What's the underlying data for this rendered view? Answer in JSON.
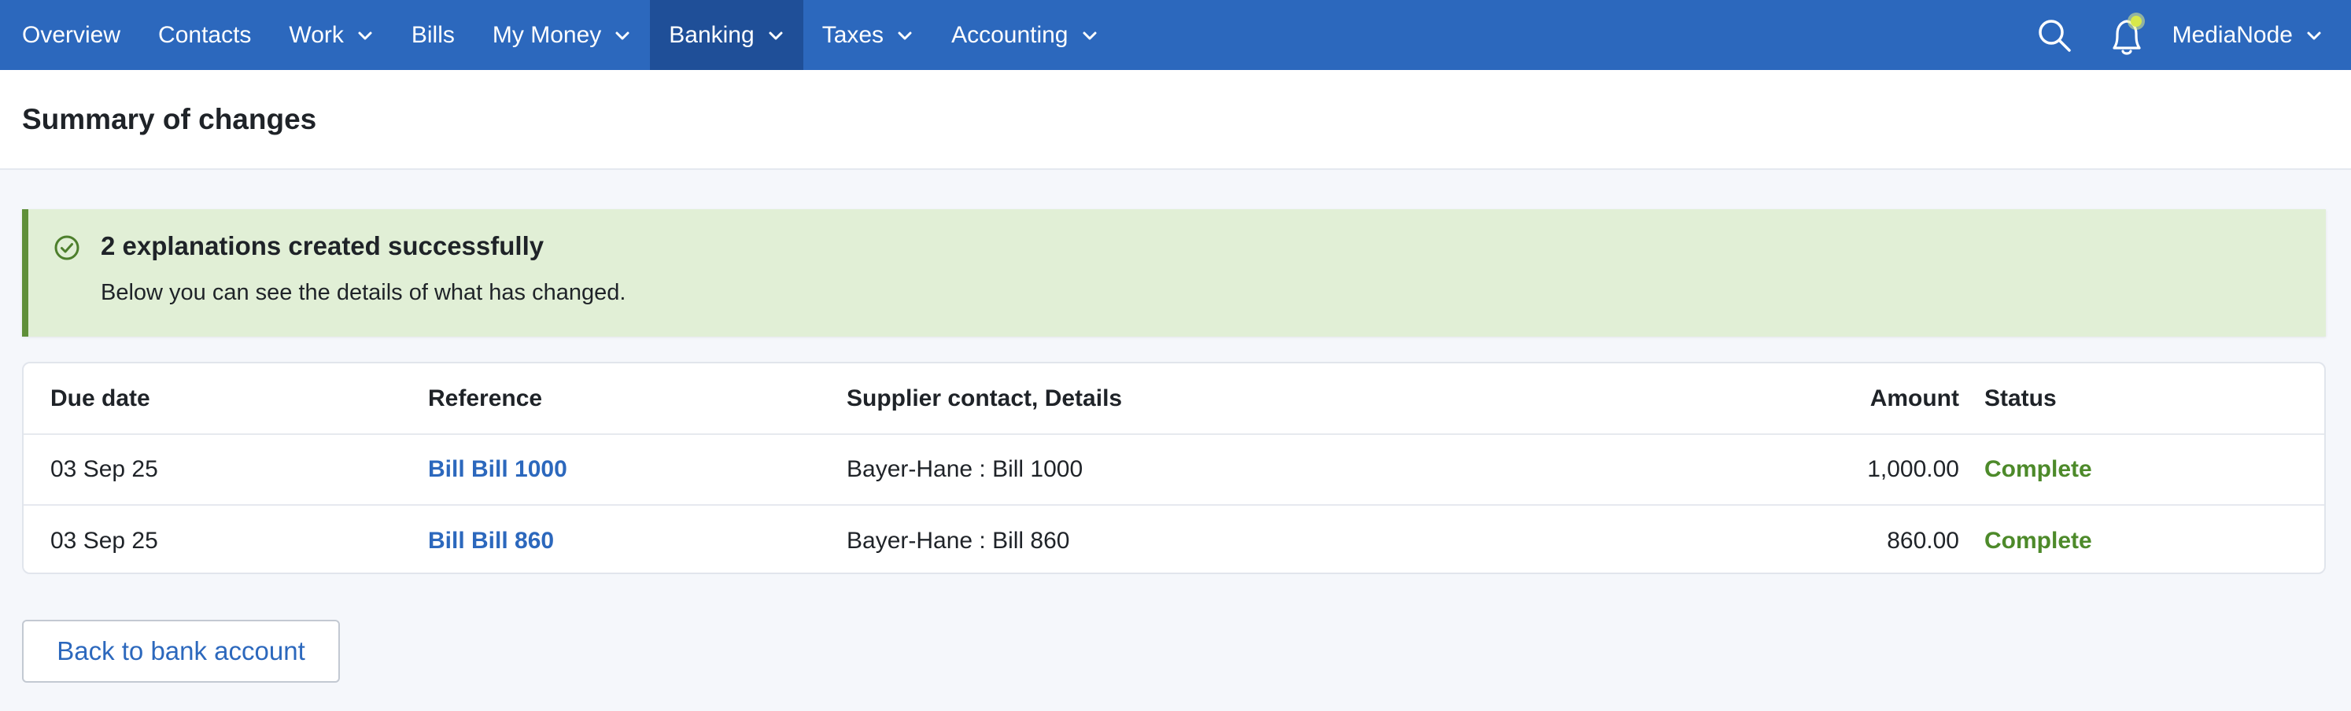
{
  "nav": {
    "items": [
      {
        "label": "Overview",
        "has_menu": false,
        "active": false
      },
      {
        "label": "Contacts",
        "has_menu": false,
        "active": false
      },
      {
        "label": "Work",
        "has_menu": true,
        "active": false
      },
      {
        "label": "Bills",
        "has_menu": false,
        "active": false
      },
      {
        "label": "My Money",
        "has_menu": true,
        "active": false
      },
      {
        "label": "Banking",
        "has_menu": true,
        "active": true
      },
      {
        "label": "Taxes",
        "has_menu": true,
        "active": false
      },
      {
        "label": "Accounting",
        "has_menu": true,
        "active": false
      }
    ],
    "search_icon": "search-icon",
    "bell_icon": "bell-icon",
    "user": {
      "label": "MediaNode"
    }
  },
  "page": {
    "title": "Summary of changes"
  },
  "banner": {
    "icon": "check-circle-icon",
    "title": "2 explanations created successfully",
    "text": "Below you can see the details of what has changed."
  },
  "table": {
    "headers": {
      "due_date": "Due date",
      "reference": "Reference",
      "supplier": "Supplier contact, Details",
      "amount": "Amount",
      "status": "Status"
    },
    "rows": [
      {
        "due_date": "03 Sep 25",
        "reference": "Bill Bill 1000",
        "supplier": "Bayer-Hane : Bill 1000",
        "amount": "1,000.00",
        "status": "Complete"
      },
      {
        "due_date": "03 Sep 25",
        "reference": "Bill Bill 860",
        "supplier": "Bayer-Hane : Bill 860",
        "amount": "860.00",
        "status": "Complete"
      }
    ]
  },
  "actions": {
    "back_label": "Back to bank account"
  },
  "colors": {
    "nav_bg": "#2c68bd",
    "nav_active_bg": "#1f4f98",
    "success_bg": "#e1efd6",
    "success_border": "#5f8f39",
    "link": "#2c68bd",
    "status_complete": "#4d8a2a",
    "notification_dot": "#d7e84a"
  }
}
